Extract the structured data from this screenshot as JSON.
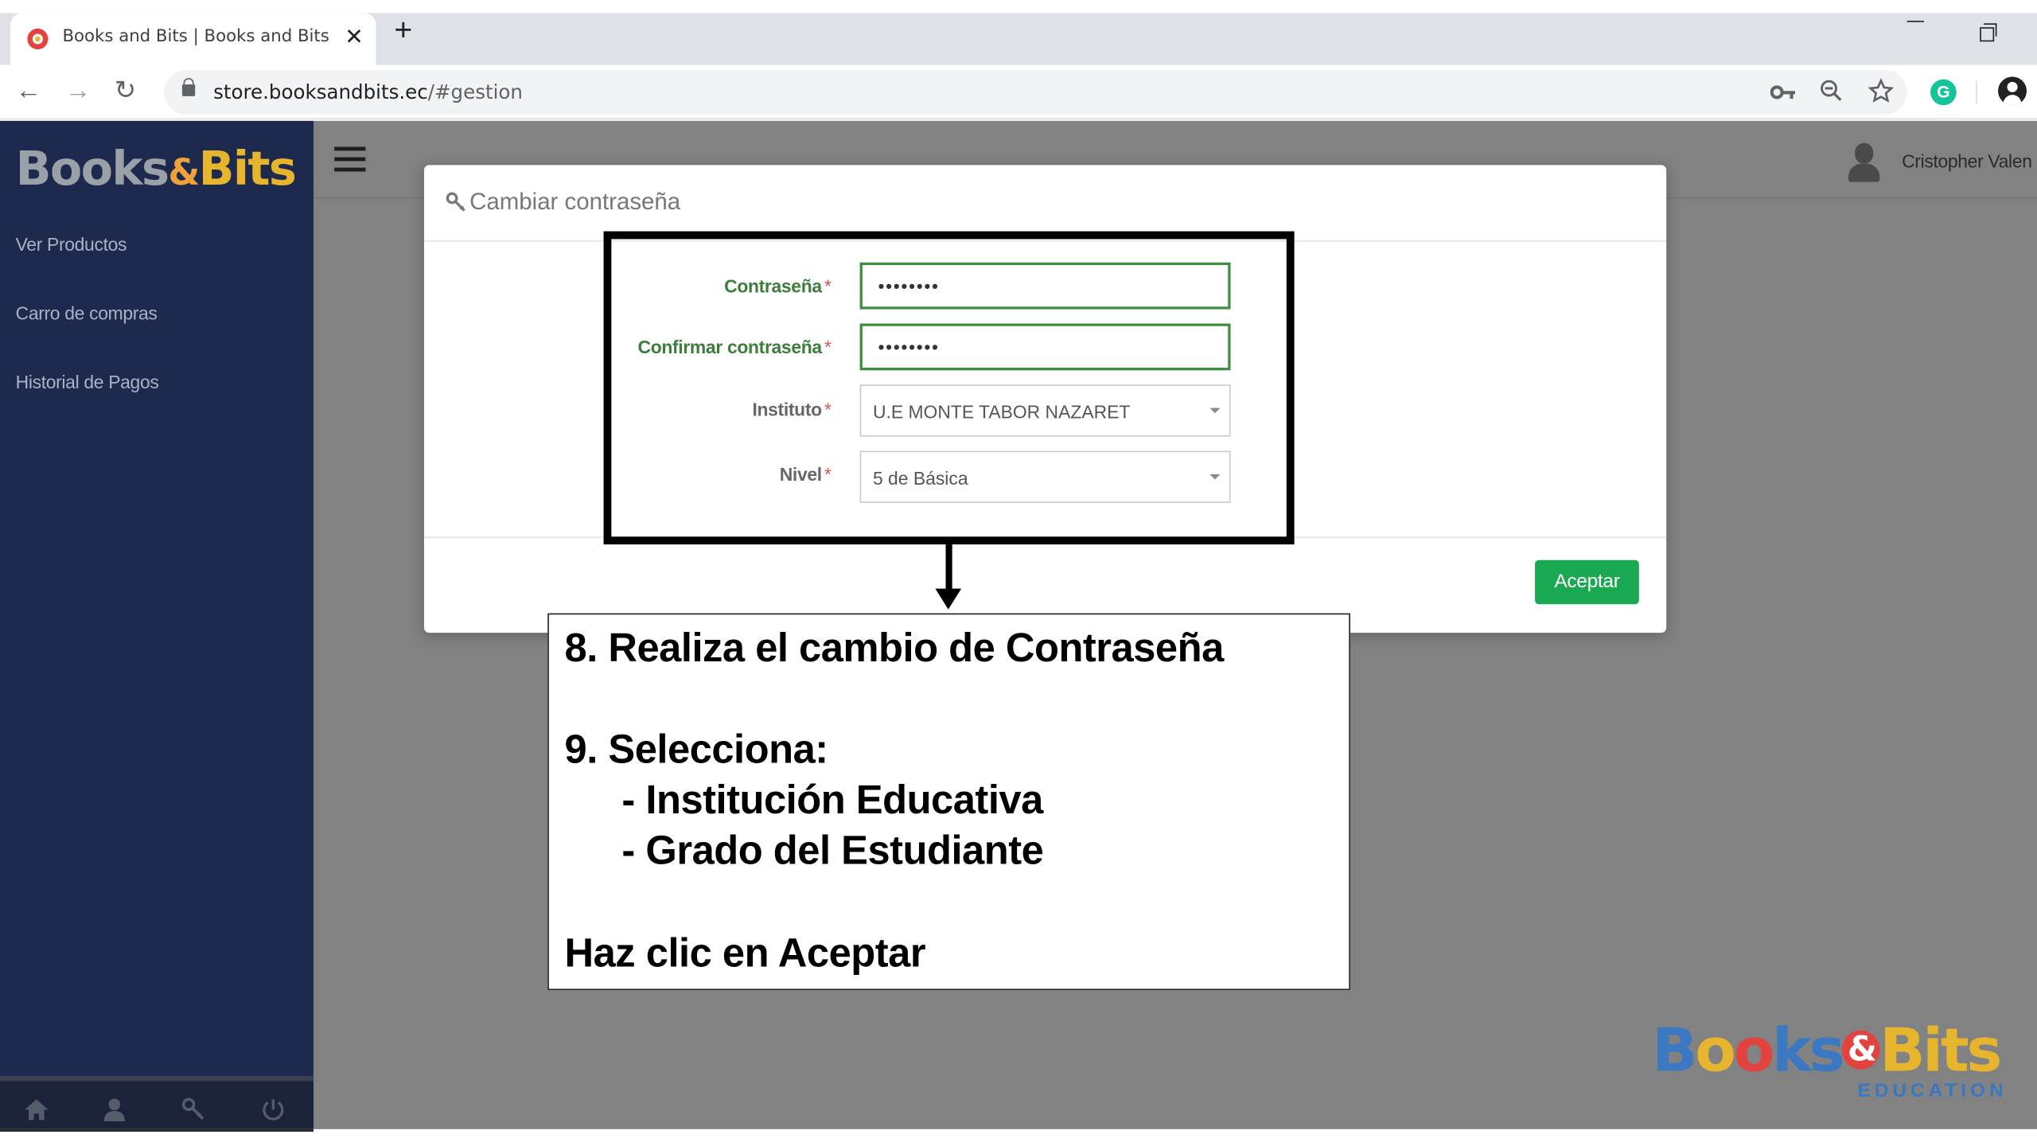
{
  "browser": {
    "tab_title": "Books and Bits | Books and Bits",
    "tab_close": "✕",
    "new_tab": "+",
    "url_host": "store.booksandbits.ec",
    "url_path": "/#gestion",
    "icons": [
      "key-icon",
      "zoom-out-icon",
      "star-icon",
      "grammarly-icon",
      "profile-icon"
    ]
  },
  "sidebar": {
    "brand_books": "Books",
    "brand_amp": "&",
    "brand_bits": "Bits",
    "items": [
      {
        "label": "Ver Productos"
      },
      {
        "label": "Carro de compras"
      },
      {
        "label": "Historial de Pagos"
      }
    ]
  },
  "header": {
    "user_name": "Cristopher Valen"
  },
  "modal": {
    "title": "Cambiar contraseña",
    "fields": {
      "password_label": "Contraseña",
      "password_value": "••••••••",
      "confirm_label": "Confirmar contraseña",
      "confirm_value": "••••••••",
      "institute_label": "Instituto",
      "institute_value": "U.E MONTE TABOR NAZARET",
      "level_label": "Nivel",
      "level_value": "5 de Básica",
      "required_mark": "*"
    },
    "accept_label": "Aceptar"
  },
  "annotation": {
    "line1": "8. Realiza el cambio de Contraseña",
    "line2": "9. Selecciona:",
    "line3": "- Institución Educativa",
    "line4": "- Grado del Estudiante",
    "line5": "Haz clic en Aceptar"
  },
  "bottom_logo": {
    "b": "B",
    "o1": "o",
    "o2": "o",
    "ks": "ks",
    "amp": "&",
    "bits": "Bits",
    "edu": "EDUCATION"
  },
  "colors": {
    "sidebar": "#1d2a4e",
    "accent_green": "#1aa853",
    "overlay": "#828282"
  }
}
